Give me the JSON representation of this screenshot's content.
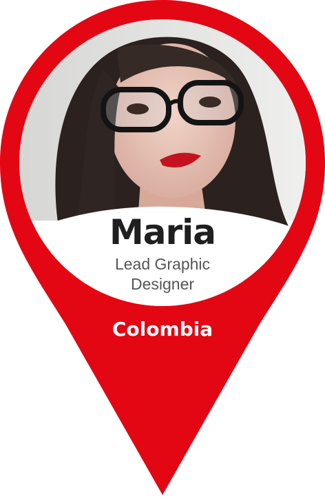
{
  "profile": {
    "name": "Maria",
    "role_line1": "Lead Graphic",
    "role_line2": "Designer",
    "country": "Colombia"
  },
  "colors": {
    "pin": "#e30613",
    "name_text": "#1f1f1f",
    "role_text": "#555555",
    "country_text": "#ffffff"
  },
  "icons": {
    "marker": "map-pin-icon"
  }
}
